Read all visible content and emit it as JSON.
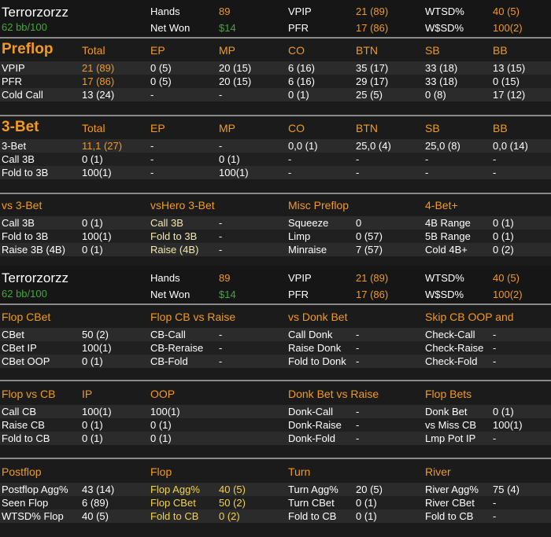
{
  "player": {
    "name": "Terrorzorzz",
    "winrate": "62 bb/100"
  },
  "summary": [
    {
      "label": "Hands",
      "value": "89"
    },
    {
      "label": "Net Won",
      "value": "$14"
    },
    {
      "label": "VPIP",
      "value": "21 (89)"
    },
    {
      "label": "PFR",
      "value": "17 (86)"
    },
    {
      "label": "WTSD%",
      "value": "40 (5)"
    },
    {
      "label": "W$SD%",
      "value": "100(2)"
    }
  ],
  "preflop": {
    "title": "Preflop",
    "cols": [
      "Total",
      "EP",
      "MP",
      "CO",
      "BTN",
      "SB",
      "BB"
    ],
    "rows": [
      {
        "label": "VPIP",
        "vals": [
          "21 (89)",
          "0 (5)",
          "20 (15)",
          "6 (16)",
          "35 (17)",
          "33 (18)",
          "13 (15)"
        ]
      },
      {
        "label": "PFR",
        "vals": [
          "17 (86)",
          "0 (5)",
          "20 (15)",
          "6 (16)",
          "29 (17)",
          "33 (18)",
          "0 (15)"
        ]
      },
      {
        "label": "Cold Call",
        "vals": [
          "13 (24)",
          "-",
          "-",
          "0 (1)",
          "25 (5)",
          "0 (8)",
          "17 (12)"
        ]
      }
    ]
  },
  "threebet": {
    "title": "3-Bet",
    "cols": [
      "Total",
      "EP",
      "MP",
      "CO",
      "BTN",
      "SB",
      "BB"
    ],
    "rows": [
      {
        "label": "3-Bet",
        "vals": [
          "11,1 (27)",
          "-",
          "-",
          "0,0 (1)",
          "25,0 (4)",
          "25,0 (8)",
          "0,0 (14)"
        ]
      },
      {
        "label": "Call 3B",
        "vals": [
          "0 (1)",
          "-",
          "0 (1)",
          "-",
          "-",
          "-",
          "-"
        ]
      },
      {
        "label": "Fold to 3B",
        "vals": [
          "100(1)",
          "-",
          "100(1)",
          "-",
          "-",
          "-",
          "-"
        ]
      }
    ]
  },
  "misc": {
    "heads": [
      "vs 3-Bet",
      "vsHero 3-Bet",
      "Misc Preflop",
      "4-Bet+"
    ],
    "rows": [
      [
        "Call 3B",
        "0 (1)",
        "Call 3B",
        "-",
        "Squeeze",
        "0",
        "4B Range",
        "0 (1)"
      ],
      [
        "Fold to 3B",
        "100(1)",
        "Fold to 3B",
        "-",
        "Limp",
        "0 (57)",
        "5B Range",
        "0 (1)"
      ],
      [
        "Raise 3B (4B)",
        "0 (1)",
        "Raise (4B)",
        "-",
        "Minraise",
        "7 (57)",
        "Cold 4B+",
        "0 (2)"
      ]
    ]
  },
  "flop1": {
    "heads": [
      "Flop CBet",
      "Flop CB vs Raise",
      "vs Donk Bet",
      "Skip CB OOP and"
    ],
    "rows": [
      [
        "CBet",
        "50 (2)",
        "CB-Call",
        "-",
        "Call Donk",
        "-",
        "Check-Call",
        "-"
      ],
      [
        "CBet IP",
        "100(1)",
        "CB-Reraise",
        "-",
        "Raise Donk",
        "-",
        "Check-Raise",
        "-"
      ],
      [
        "CBet OOP",
        "0 (1)",
        "CB-Fold",
        "-",
        "Fold to Donk",
        "-",
        "Check-Fold",
        "-"
      ]
    ]
  },
  "flop2": {
    "heads": [
      "Flop vs CB",
      "IP",
      "OOP",
      "Donk Bet vs Raise",
      "Flop Bets"
    ],
    "rows": [
      [
        "Call CB",
        "100(1)",
        "100(1)",
        "Donk-Call",
        "-",
        "Donk Bet",
        "0 (1)"
      ],
      [
        "Raise CB",
        "0 (1)",
        "0 (1)",
        "Donk-Raise",
        "-",
        "vs Miss CB",
        "100(1)"
      ],
      [
        "Fold to CB",
        "0 (1)",
        "0 (1)",
        "Donk-Fold",
        "-",
        "Lmp Pot IP",
        "-"
      ]
    ]
  },
  "postflop": {
    "heads": [
      "Postflop",
      "Flop",
      "Turn",
      "River"
    ],
    "rows": [
      [
        "Postflop Agg%",
        "43 (14)",
        "Flop Agg%",
        "40 (5)",
        "Turn Agg%",
        "20 (5)",
        "River Agg%",
        "75 (4)"
      ],
      [
        "Seen Flop",
        "6 (89)",
        "Flop CBet",
        "50 (2)",
        "Turn CBet",
        "0 (1)",
        "River CBet",
        "-"
      ],
      [
        "WTSD% Flop",
        "40 (5)",
        "Fold to CB",
        "0 (2)",
        "Fold to CB",
        "0 (1)",
        "Fold to CB",
        "-"
      ]
    ]
  }
}
